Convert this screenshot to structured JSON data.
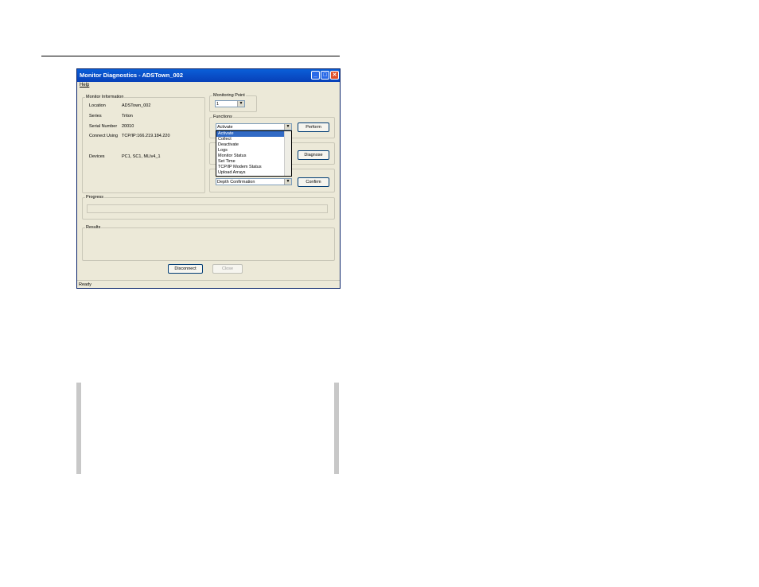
{
  "window": {
    "title": "Monitor Diagnostics - ADSTown_002",
    "menu_help": "Help",
    "status": "Ready"
  },
  "monitor_info": {
    "legend": "Monitor Information",
    "fields": [
      {
        "label": "Location",
        "value": "ADSTown_002"
      },
      {
        "label": "Series",
        "value": "Triton"
      },
      {
        "label": "Serial Number",
        "value": "20010"
      },
      {
        "label": "Connect Using",
        "value": "TCP/IP:166.219.184.220"
      },
      {
        "label": "Devices",
        "value": "PC1, SC1, MLIv4_1"
      }
    ]
  },
  "monitoring_point": {
    "legend": "Monitoring Point",
    "value": "1"
  },
  "functions": {
    "legend": "Functions",
    "selected": "Activate",
    "perform_label": "Perform",
    "options": [
      "Activate",
      "Collect",
      "Deactivate",
      "Logs",
      "Monitor Status",
      "Set Time",
      "TCP/IP Modem Status",
      "Upload Arrays"
    ]
  },
  "diagnostics": {
    "diagnose_label": "Diagnose"
  },
  "confirmation": {
    "selected": "Depth Confirmation",
    "confirm_label": "Confirm"
  },
  "progress": {
    "legend": "Progress"
  },
  "results": {
    "legend": "Results"
  },
  "buttons": {
    "disconnect": "Disconnect",
    "close": "Close"
  },
  "colors": {
    "titlebar": "#0a5fd8",
    "dialog_bg": "#ece9d8",
    "selection": "#316ac5"
  }
}
